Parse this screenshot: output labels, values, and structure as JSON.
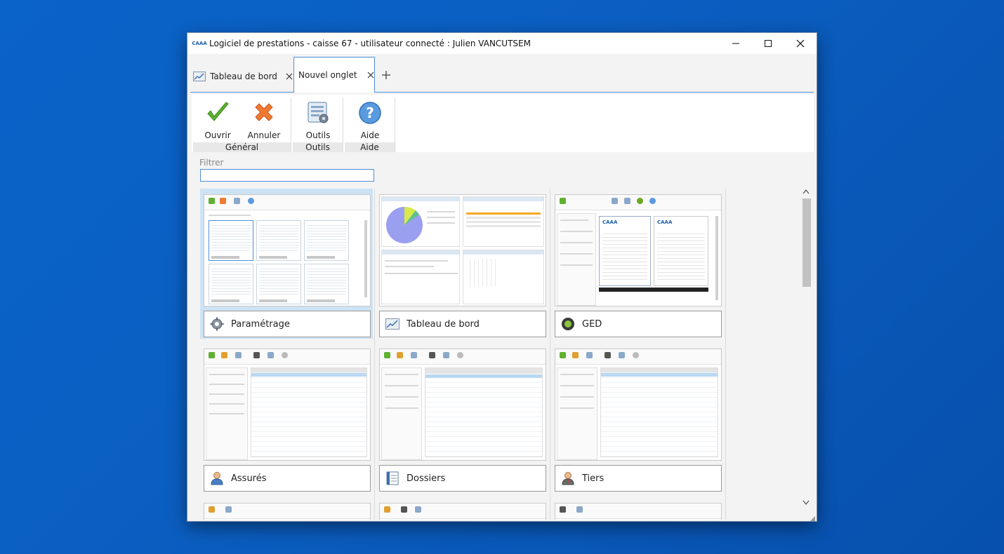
{
  "window": {
    "logo_text": "CAAA",
    "title": "Logiciel de prestations - caisse 67 - utilisateur connecté : Julien VANCUTSEM"
  },
  "tabs": [
    {
      "label": "Tableau de bord",
      "active": false
    },
    {
      "label": "Nouvel onglet",
      "active": true
    }
  ],
  "ribbon": {
    "groups": [
      {
        "label": "Général",
        "buttons": [
          "Ouvrir",
          "Annuler"
        ]
      },
      {
        "label": "Outils",
        "buttons": [
          "Outils"
        ]
      },
      {
        "label": "Aide",
        "buttons": [
          "Aide"
        ]
      }
    ]
  },
  "filter": {
    "label": "Filtrer",
    "value": ""
  },
  "modules": [
    {
      "label": "Paramétrage",
      "icon": "gear-icon",
      "selected": true
    },
    {
      "label": "Tableau de bord",
      "icon": "dashboard-icon",
      "selected": false
    },
    {
      "label": "GED",
      "icon": "ged-icon",
      "selected": false
    },
    {
      "label": "Assurés",
      "icon": "user-icon",
      "selected": false
    },
    {
      "label": "Dossiers",
      "icon": "folder-icon",
      "selected": false
    },
    {
      "label": "Tiers",
      "icon": "third-party-icon",
      "selected": false
    }
  ],
  "colors": {
    "accent": "#4a90d9",
    "selected_bg": "#cde3f4",
    "desktop": "#0a63c9"
  }
}
